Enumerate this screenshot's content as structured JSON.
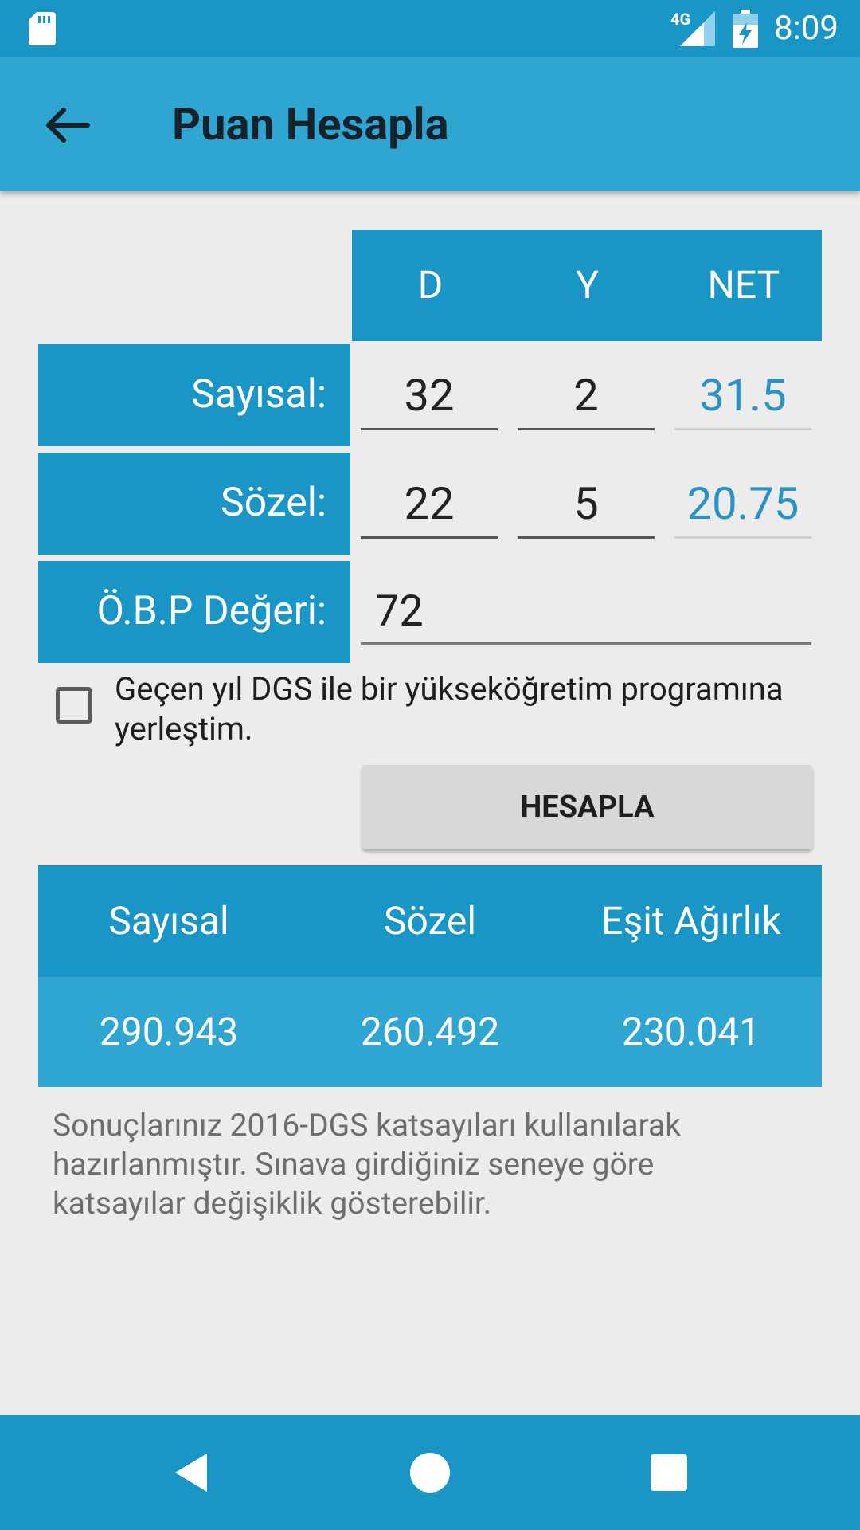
{
  "status_bar": {
    "time": "8:09",
    "network": "4G",
    "icons": [
      "sd-card-icon",
      "signal-icon",
      "battery-charging-icon"
    ]
  },
  "app_bar": {
    "title": "Puan Hesapla",
    "back_icon": "arrow-left-icon"
  },
  "table": {
    "columns": [
      "D",
      "Y",
      "NET"
    ],
    "rows": [
      {
        "label": "Sayısal:",
        "d": "32",
        "y": "2",
        "net": "31.5"
      },
      {
        "label": "Sözel:",
        "d": "22",
        "y": "5",
        "net": "20.75"
      }
    ],
    "obp": {
      "label": "Ö.B.P Değeri:",
      "value": "72"
    }
  },
  "checkbox": {
    "label": "Geçen yıl DGS ile bir yükseköğretim programına yerleştim.",
    "checked": false
  },
  "calculate_button": {
    "label": "HESAPLA"
  },
  "results": {
    "headers": [
      "Sayısal",
      "Sözel",
      "Eşit Ağırlık"
    ],
    "values": [
      "290.943",
      "260.492",
      "230.041"
    ]
  },
  "note": "Sonuçlarınız 2016-DGS katsayıları kullanılarak hazırlanmıştır. Sınava girdiğiniz seneye göre katsayılar değişiklik gösterebilir.",
  "nav_bar": {
    "icons": [
      "back-triangle-icon",
      "home-circle-icon",
      "recents-square-icon"
    ]
  },
  "colors": {
    "primary": "#1a96c6",
    "primary_light": "#2fa5d2",
    "net_text": "#2a93c3",
    "background": "#ececec"
  }
}
